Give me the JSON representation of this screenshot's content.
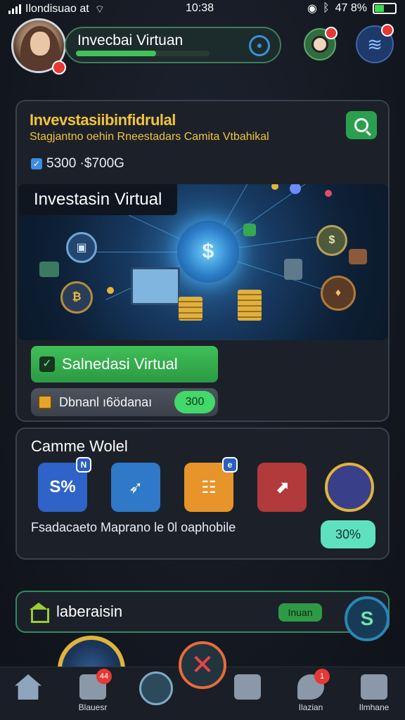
{
  "status_bar": {
    "carrier": "Ilondisuao at",
    "time": "10:38",
    "battery": "47 8%",
    "battery_level": 0.47
  },
  "header": {
    "title": "Invecbai Virtuan",
    "progress": 0.6,
    "icons": [
      "target-icon",
      "profile-icon",
      "menu-icon"
    ]
  },
  "main_card": {
    "heading": "Invevstasiibinfidrulal",
    "subheading": "Stagjantno oehin Rneestadars Camita Vtbahikal",
    "range": "5300 ·$700G",
    "hero_label": "Investasin Virtual",
    "hero_core_symbol": "$",
    "primary_button": "Salnedasi Virtual",
    "donation_label": "Dbnanl ı6ödanaı",
    "donation_amount": "300"
  },
  "game_card": {
    "heading": "Camme Wolel",
    "tiles": [
      {
        "icon": "percent-icon",
        "text": "S%",
        "badge": "N",
        "color": "#2f63c8"
      },
      {
        "icon": "rocket-icon",
        "text": "➶",
        "color": "#2f79c8"
      },
      {
        "icon": "document-icon",
        "text": "☷",
        "badge": "e",
        "color": "#e7942a"
      },
      {
        "icon": "growth-chart-icon",
        "text": "⬈",
        "color": "#b23a3a"
      },
      {
        "icon": "advisor-avatar-icon",
        "text": "",
        "color": "#3a3f8a"
      }
    ],
    "description": "Fsadacaeto Maprano le 0l oaphobile",
    "percent": "30%"
  },
  "bottom_card": {
    "label": "laberaisin",
    "tag": "Inuan",
    "fab_symbol": "S"
  },
  "nav": {
    "close_symbol": "✕",
    "items": [
      {
        "label": "",
        "icon": "home-icon"
      },
      {
        "label": "Blauesr",
        "icon": "portfolio-icon",
        "badge": "44"
      },
      {
        "label": "",
        "icon": "support-icon"
      },
      {
        "label": "",
        "icon": "wallet-icon"
      },
      {
        "label": "Ilazian",
        "icon": "chat-icon",
        "badge": "1"
      },
      {
        "label": "Ilmhane",
        "icon": "market-icon"
      }
    ]
  }
}
